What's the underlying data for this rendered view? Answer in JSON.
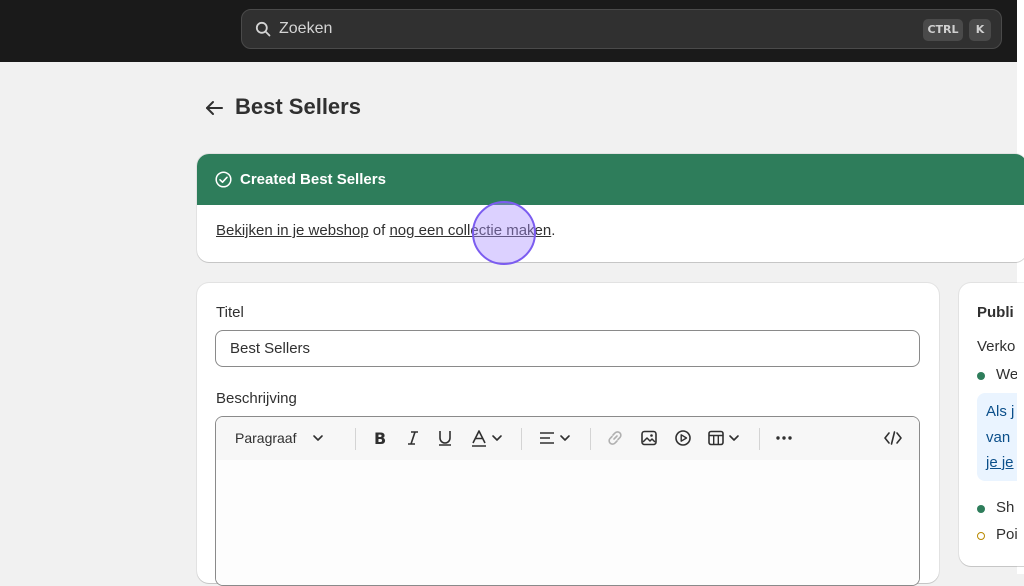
{
  "search": {
    "placeholder": "Zoeken",
    "shortcut_ctrl": "CTRL",
    "shortcut_key": "K"
  },
  "page": {
    "title": "Best Sellers"
  },
  "banner": {
    "title": "Created Best Sellers",
    "link_view": "Bekijken in je webshop",
    "connector": "of",
    "link_new": "nog een collectie maken",
    "trailing": "."
  },
  "form": {
    "title_label": "Titel",
    "title_value": "Best Sellers",
    "description_label": "Beschrijving",
    "toolbar": {
      "paragraph": "Paragraaf"
    }
  },
  "sidebar": {
    "title": "Publi",
    "subtitle": "Verko",
    "channel_1": "We",
    "info_line_1": "Als j",
    "info_line_2": "van",
    "info_line_3": "je je",
    "channel_2": "Sh",
    "channel_3": "Poi"
  },
  "colors": {
    "banner_green": "#2e7d5b",
    "topbar": "#1a1a1a",
    "status_active": "#2e7d5b",
    "status_pending": "#b98900",
    "info_text": "#0b4f8a"
  }
}
